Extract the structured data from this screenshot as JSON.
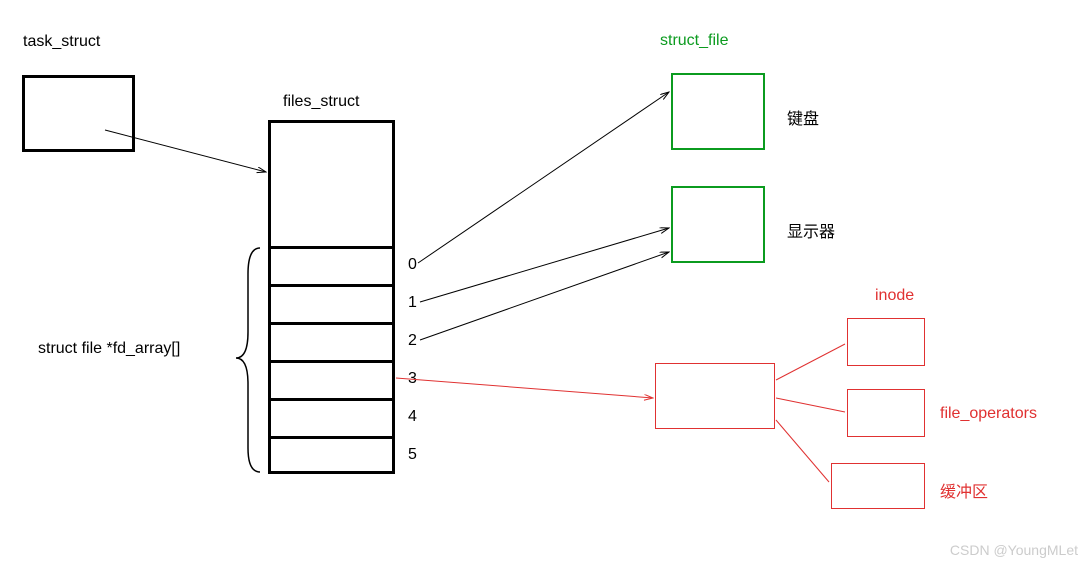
{
  "labels": {
    "task_struct": "task_struct",
    "files_struct": "files_struct",
    "struct_file": "struct_file",
    "fd_array": "struct file *fd_array[]",
    "keyboard": "键盘",
    "display": "显示器",
    "inode": "inode",
    "file_operators": "file_operators",
    "buffer": "缓冲区",
    "idx0": "0",
    "idx1": "1",
    "idx2": "2",
    "idx3": "3",
    "idx4": "4",
    "idx5": "5",
    "watermark": "CSDN @YoungMLet"
  },
  "colors": {
    "black": "#000000",
    "green": "#0b9b1f",
    "red": "#e03131"
  }
}
